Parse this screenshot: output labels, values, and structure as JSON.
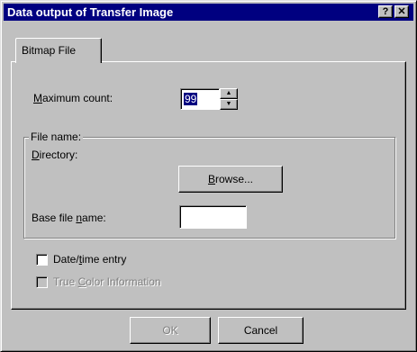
{
  "window": {
    "title": "Data output of Transfer Image",
    "help_button": "?",
    "close_button": "✕"
  },
  "tabs": [
    {
      "label": "Bitmap File"
    }
  ],
  "maximum_count": {
    "label_prefix": "",
    "label_hotkey": "M",
    "label_suffix": "aximum count:",
    "value": "99"
  },
  "file_name": {
    "group_label": "File name:",
    "directory_label_hotkey": "D",
    "directory_label_suffix": "irectory:",
    "browse_button_hotkey": "B",
    "browse_button_suffix": "rowse...",
    "base_label_prefix": "Base file ",
    "base_label_hotkey": "n",
    "base_label_suffix": "ame:",
    "base_value": ""
  },
  "options": {
    "date_prefix": "Date/",
    "date_hotkey": "t",
    "date_suffix": "ime entry",
    "date_checked": false,
    "color_prefix": "True ",
    "color_hotkey": "C",
    "color_suffix": "olor Information",
    "color_checked": false,
    "color_enabled": false
  },
  "buttons": {
    "ok": "OK",
    "cancel": "Cancel"
  },
  "icons": {
    "spin_up": "spin-up-arrow-icon",
    "spin_down": "spin-down-arrow-icon"
  }
}
